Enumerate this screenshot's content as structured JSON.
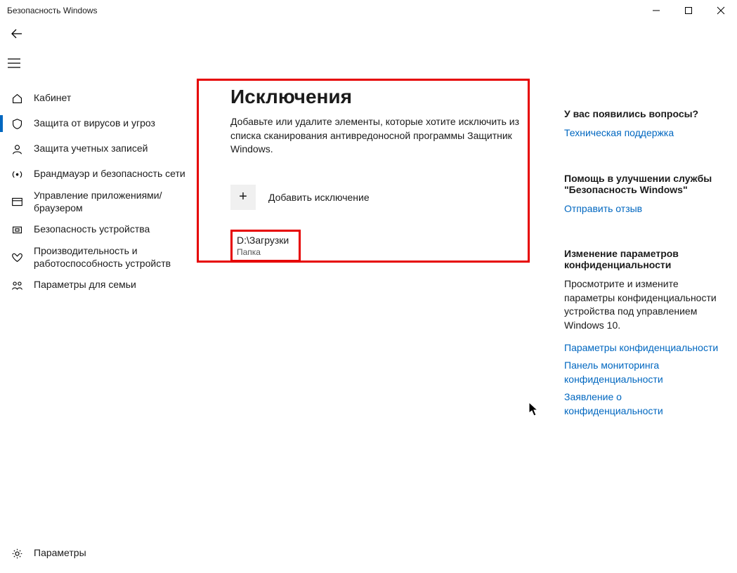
{
  "window": {
    "title": "Безопасность Windows"
  },
  "sidebar": {
    "items": [
      {
        "label": "Кабинет"
      },
      {
        "label": "Защита от вирусов и угроз"
      },
      {
        "label": "Защита учетных записей"
      },
      {
        "label": "Брандмауэр и безопасность сети"
      },
      {
        "label": "Управление приложениями/браузером"
      },
      {
        "label": "Безопасность устройства"
      },
      {
        "label": "Производительность и работоспособность устройств"
      },
      {
        "label": "Параметры для семьи"
      }
    ],
    "settings": "Параметры"
  },
  "main": {
    "title": "Исключения",
    "description": "Добавьте или удалите элементы, которые хотите исключить из списка сканирования антивредоносной программы Защитник Windows.",
    "add_label": "Добавить исключение",
    "exclusion": {
      "path": "D:\\Загрузки",
      "type": "Папка"
    }
  },
  "right": {
    "q_head": "У вас появились вопросы?",
    "q_link": "Техническая поддержка",
    "help_head": "Помощь в улучшении службы \"Безопасность Windows\"",
    "help_link": "Отправить отзыв",
    "priv_head": "Изменение параметров конфиденциальности",
    "priv_text": "Просмотрите и измените параметры конфиденциальности устройства под управлением Windows 10.",
    "priv_link1": "Параметры конфиденциальности",
    "priv_link2": "Панель мониторинга конфиденциальности",
    "priv_link3": "Заявление о конфиденциальности"
  }
}
